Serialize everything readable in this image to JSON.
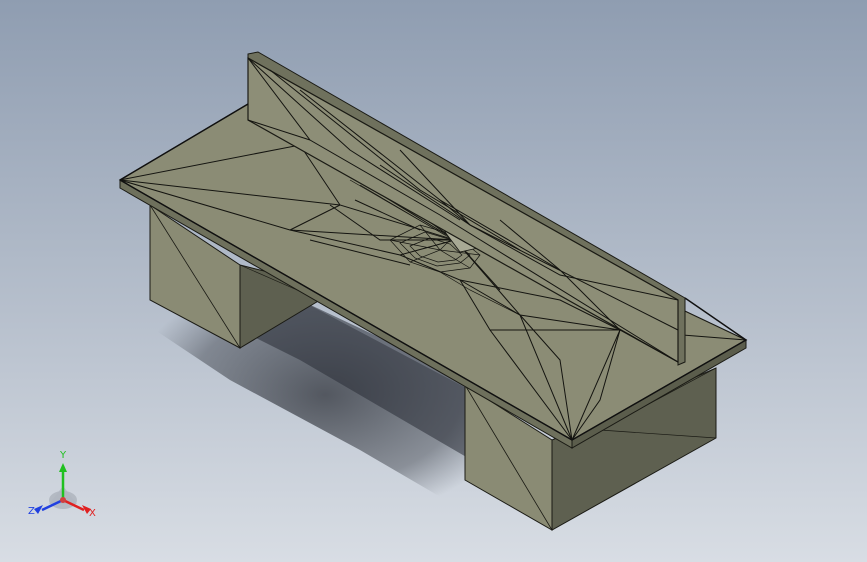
{
  "viewport": {
    "background_top": "#8f9db1",
    "background_bottom": "#d8dde4",
    "model_face_color": "#8b8c75",
    "model_side_color": "#6e705c",
    "edge_color": "#1a1a14"
  },
  "triad": {
    "x_label": "X",
    "y_label": "Y",
    "z_label": "Z",
    "x_color": "#e02020",
    "y_color": "#20c020",
    "z_color": "#2040e0"
  }
}
